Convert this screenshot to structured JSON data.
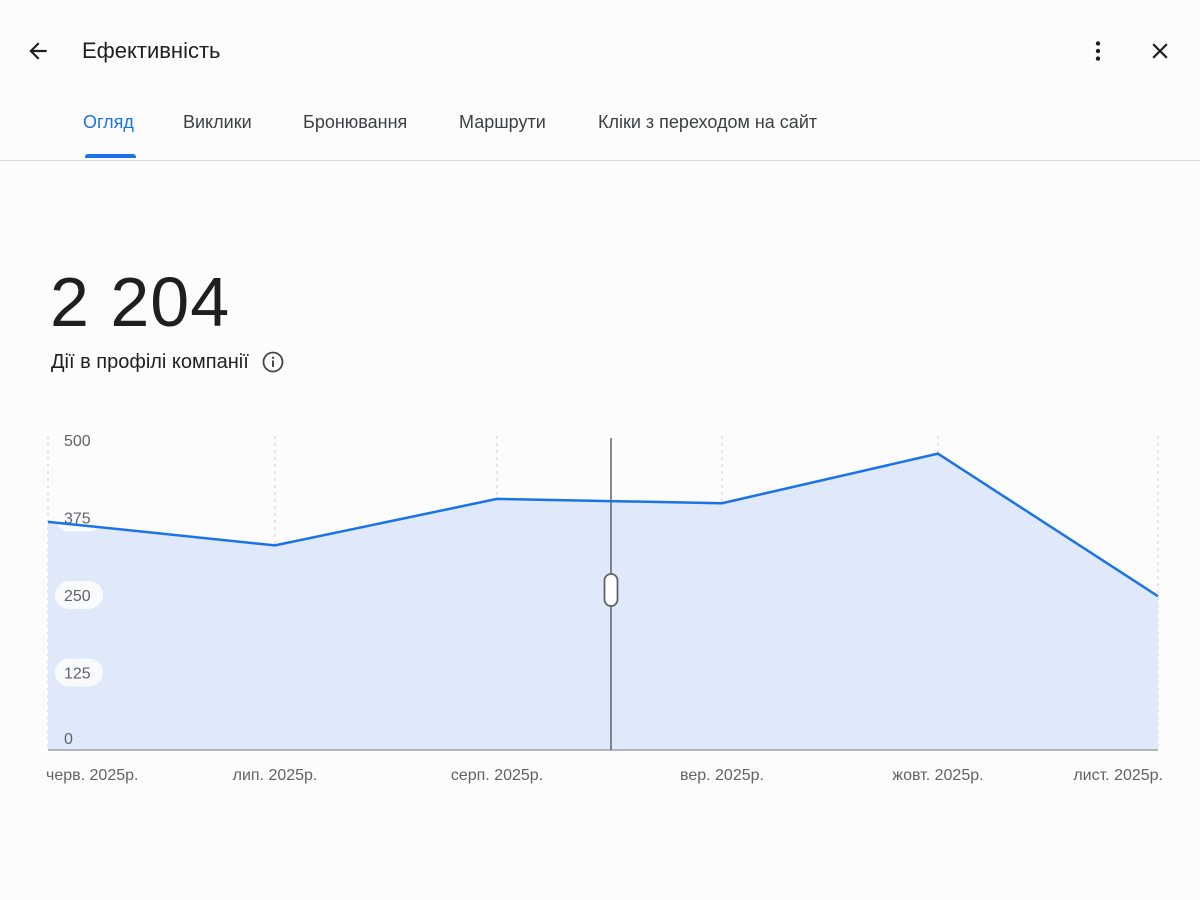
{
  "header": {
    "title": "Ефективність",
    "back_icon": "arrow-back-icon",
    "more_icon": "more-vert-icon",
    "close_icon": "close-icon"
  },
  "tabs": [
    {
      "label": "Огляд",
      "active": true
    },
    {
      "label": "Виклики",
      "active": false
    },
    {
      "label": "Бронювання",
      "active": false
    },
    {
      "label": "Маршрути",
      "active": false
    },
    {
      "label": "Кліки з переходом на сайт",
      "active": false
    }
  ],
  "metric": {
    "value": "2 204",
    "label": "Дії в профілі компанії",
    "info_icon": "info-icon"
  },
  "colors": {
    "accent": "#1a73e8",
    "area_fill": "#dfe9fa",
    "grid": "#c9cdd2"
  },
  "chart_data": {
    "type": "area",
    "x": [
      "черв. 2025р.",
      "лип. 2025р.",
      "серп. 2025р.",
      "вер. 2025р.",
      "жовт. 2025р.",
      "лист. 2025р."
    ],
    "series": [
      {
        "values": [
          368,
          330,
          405,
          398,
          478,
          248
        ]
      }
    ],
    "yticks": [
      "0",
      "125",
      "250",
      "375",
      "500"
    ],
    "ylim": [
      0,
      500
    ],
    "grid": true,
    "cursor_marker": true
  }
}
